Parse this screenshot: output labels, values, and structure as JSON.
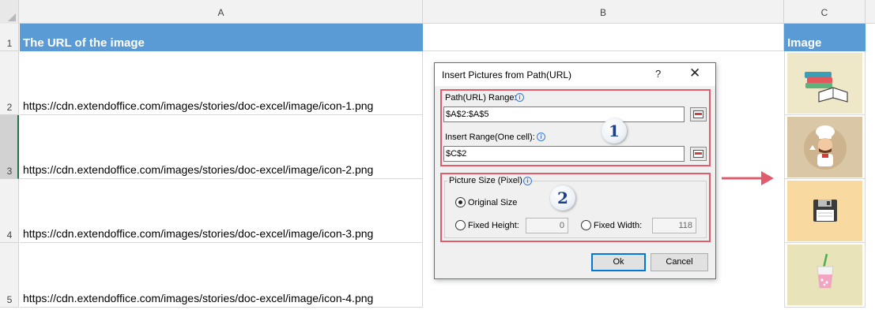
{
  "sheet": {
    "columns": [
      "A",
      "B",
      "C"
    ],
    "rows": [
      "1",
      "2",
      "3",
      "4",
      "5"
    ],
    "header_a": "The URL of the image",
    "header_c": "Image",
    "urls": [
      "https://cdn.extendoffice.com/images/stories/doc-excel/image/icon-1.png",
      "https://cdn.extendoffice.com/images/stories/doc-excel/image/icon-2.png",
      "https://cdn.extendoffice.com/images/stories/doc-excel/image/icon-3.png",
      "https://cdn.extendoffice.com/images/stories/doc-excel/image/icon-4.png"
    ],
    "images": [
      {
        "icon": "books-icon",
        "bg": "#efe8c8"
      },
      {
        "icon": "chef-icon",
        "bg": "#d9c7a6"
      },
      {
        "icon": "floppy-disk-icon",
        "bg": "#f8d9a0"
      },
      {
        "icon": "drink-icon",
        "bg": "#e8e3b8"
      }
    ],
    "header_color": "#5b9bd5"
  },
  "dialog": {
    "title": "Insert Pictures from Path(URL)",
    "help": "?",
    "close": "✕",
    "path_label": "Path(URL) Range:",
    "path_value": "$A$2:$A$5",
    "insert_label": "Insert Range(One cell):",
    "insert_value": "$C$2",
    "size_label": "Picture Size (Pixel)",
    "original_size": "Original Size",
    "fixed_height": "Fixed Height:",
    "fixed_height_value": "0",
    "fixed_width": "Fixed Width:",
    "fixed_width_value": "118",
    "ok": "Ok",
    "cancel": "Cancel",
    "badge1": "1",
    "badge2": "2",
    "highlight_color": "#e05c6c"
  }
}
